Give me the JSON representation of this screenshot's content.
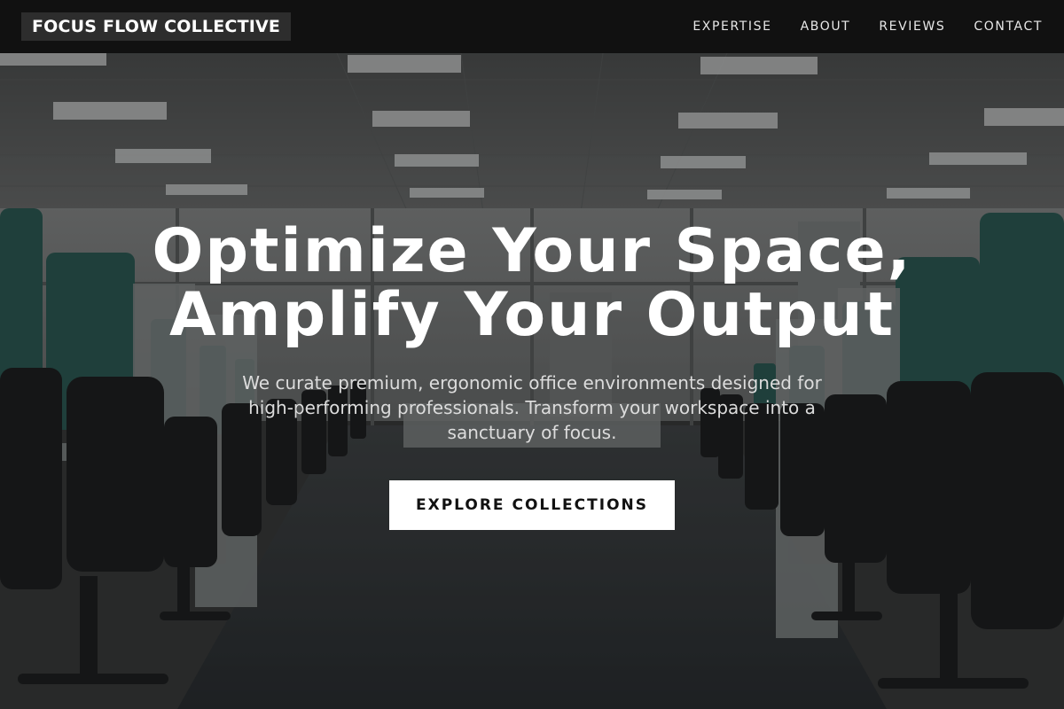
{
  "nav": {
    "brand": "FOCUS FLOW COLLECTIVE",
    "links": [
      "EXPERTISE",
      "ABOUT",
      "REVIEWS",
      "CONTACT"
    ]
  },
  "hero": {
    "title_line1": "Optimize Your Space,",
    "title_line2": "Amplify Your Output",
    "subtitle": "We curate premium, ergonomic office environments designed for high-performing professionals. Transform your workspace into a sanctuary of focus.",
    "cta_label": "EXPLORE COLLECTIONS",
    "background_image": "office-cubicles-photo"
  },
  "colors": {
    "nav_bg": "#111111",
    "brand_bg": "#2d2d2d",
    "cubicle_teal": "#2f5e58",
    "cta_bg": "#ffffff",
    "cta_text": "#111111"
  }
}
